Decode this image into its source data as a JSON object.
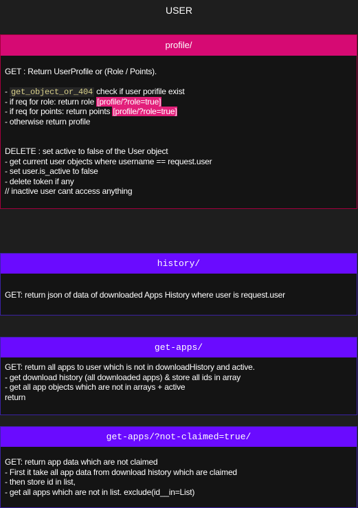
{
  "title": "USER",
  "profile": {
    "header": "profile/",
    "get_line": "GET : Return UserProfile or (Role / Points).",
    "check_code": "get_object_or_404",
    "check_text": " check if user porifile exist",
    "role_prefix": "- if req for role: return role ",
    "role_highlight": "[profile/?role=true]",
    "points_prefix": "- if req for points: return points ",
    "points_highlight": "[profile/?role=true]",
    "otherwise": "- otherwise return profile",
    "delete_line": "DELETE : set active to false of the User object",
    "delete_steps": [
      "- get current user objects where username == request.user",
      "- set user.is_active to false",
      "- delete token if any",
      "// inactive user cant access anything"
    ]
  },
  "history": {
    "header": "history/",
    "lines": [
      "GET: return json of data of downloaded Apps History where user is request.user"
    ]
  },
  "get_apps": {
    "header": "get-apps/",
    "lines": [
      "GET: return all apps to user which is not in downloadHistory and active.",
      "- get download history (all downloaded apps) & store all ids in array",
      "- get all app objects which are not in arrays + active",
      "return"
    ]
  },
  "not_claimed": {
    "header": "get-apps/?not-claimed=true/",
    "lines": [
      "GET: return app data which are not claimed",
      "- First it take all app data from download history which are claimed",
      "- then store id in list,",
      "- get all apps which are not in list. exclude(id__in=List)"
    ]
  },
  "colors": {
    "background": "#1e1e1e",
    "card_background": "#141414",
    "profile_header": "#d60a73",
    "purple_header": "#6a0bff",
    "highlight": "#e21f7a",
    "code_text": "#d8d08a"
  }
}
